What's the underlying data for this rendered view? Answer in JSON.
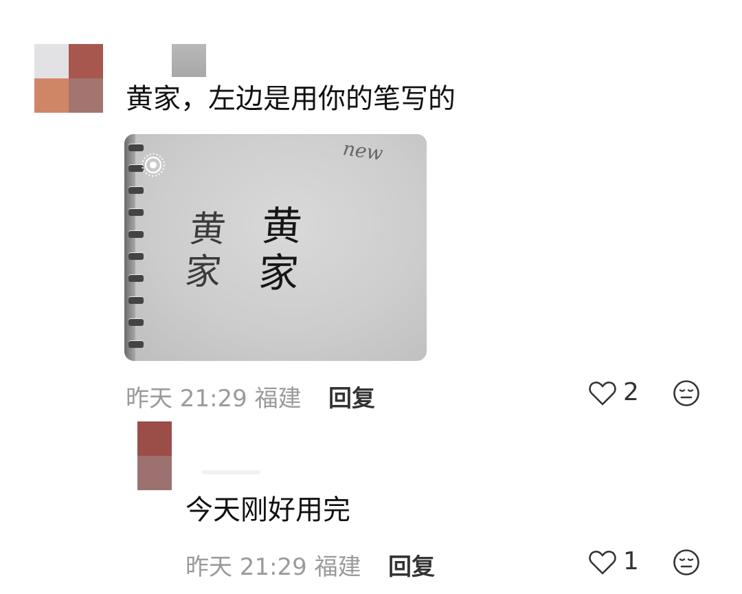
{
  "comments": [
    {
      "text": "黄家，左边是用你的笔写的",
      "time": "昨天 21:29 福建",
      "reply_label": "回复",
      "likes": "2",
      "photo_text": {
        "top_note": "new",
        "left_chars": "黄\n家",
        "right_chars": "黄\n家"
      }
    },
    {
      "text": "今天刚好用完",
      "time": "昨天 21:29 福建",
      "reply_label": "回复",
      "likes": "1"
    }
  ]
}
